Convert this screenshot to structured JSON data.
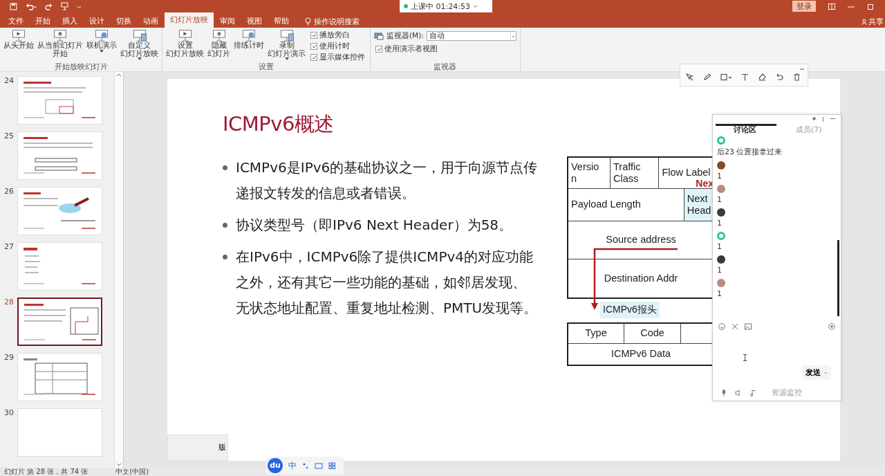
{
  "title_bar": {
    "status": "上课中 01:24:53",
    "login": "登录"
  },
  "ribbon_tabs": [
    {
      "label": "文件",
      "selected": false
    },
    {
      "label": "开始",
      "selected": false
    },
    {
      "label": "插入",
      "selected": false
    },
    {
      "label": "设计",
      "selected": false
    },
    {
      "label": "切换",
      "selected": false
    },
    {
      "label": "动画",
      "selected": false
    },
    {
      "label": "幻灯片放映",
      "selected": true
    },
    {
      "label": "审阅",
      "selected": false
    },
    {
      "label": "视图",
      "selected": false
    },
    {
      "label": "帮助",
      "selected": false
    }
  ],
  "search": "操作说明搜索",
  "share": "共享",
  "ribbon_groups": [
    {
      "label": "开始放映幻灯片",
      "items": [
        {
          "kind": "button",
          "lines": [
            "从头开始"
          ],
          "has_menu": false
        },
        {
          "kind": "button",
          "lines": [
            "从当前幻灯片",
            "开始"
          ],
          "has_menu": false
        },
        {
          "kind": "button",
          "lines": [
            "联机演示"
          ],
          "has_menu": true
        },
        {
          "kind": "button",
          "lines": [
            "自定义",
            "幻灯片放映"
          ],
          "has_menu": true
        }
      ]
    },
    {
      "label": "设置",
      "items": [
        {
          "kind": "button",
          "lines": [
            "设置",
            "幻灯片放映"
          ],
          "has_menu": false
        },
        {
          "kind": "button",
          "lines": [
            "隐藏",
            "幻灯片"
          ],
          "has_menu": false
        },
        {
          "kind": "button",
          "lines": [
            "排练计时"
          ],
          "has_menu": false
        },
        {
          "kind": "button",
          "lines": [
            "录制",
            "幻灯片演示"
          ],
          "has_menu": true
        },
        {
          "kind": "checks",
          "items": [
            {
              "label": "播放旁白",
              "checked": true
            },
            {
              "label": "使用计时",
              "checked": true
            },
            {
              "label": "显示媒体控件",
              "checked": true
            }
          ]
        }
      ]
    },
    {
      "label": "监视器",
      "items": [
        {
          "kind": "field",
          "label": "监视器(M):",
          "value": "自动"
        },
        {
          "kind": "checks",
          "items": [
            {
              "label": "使用演示者视图",
              "checked": true
            }
          ]
        }
      ]
    }
  ],
  "thumbnails": [
    {
      "number": "24",
      "selected": false
    },
    {
      "number": "25",
      "selected": false
    },
    {
      "number": "26",
      "selected": false
    },
    {
      "number": "27",
      "selected": false
    },
    {
      "number": "28",
      "selected": true
    },
    {
      "number": "29",
      "selected": false
    },
    {
      "number": "30",
      "selected": false
    }
  ],
  "slide": {
    "title": "ICMPv6概述",
    "bullets": [
      "ICMPv6是IPv6的基础协议之一，用于向源节点传递报文转发的信息或者错误。",
      "协议类型号（即IPv6 Next Header）为58。",
      "在IPv6中，ICMPv6除了提供ICMPv4的对应功能之外，还有其它一些功能的基础，如邻居发现、无状态地址配置、重复地址检测、PMTU发现等。"
    ],
    "ipv6_header": [
      {
        "cells": [
          {
            "text": "Versio\nn",
            "highlight": false
          },
          {
            "text": "Traffic\nClass",
            "highlight": false
          },
          {
            "text": "Flow Label",
            "highlight": false,
            "note": "Nex"
          }
        ]
      },
      {
        "cells": [
          {
            "text": "Payload Length",
            "highlight": false
          },
          {
            "text": "Next\nHead",
            "highlight": true
          }
        ]
      },
      {
        "cells": [
          {
            "text": "Source address",
            "highlight": false
          }
        ]
      },
      {
        "cells": [
          {
            "text": "Destination Addr",
            "highlight": false
          }
        ]
      }
    ],
    "arrow_label": "ICMPv6报头",
    "icmp_header": [
      {
        "open_end": true,
        "cells": [
          {
            "text": "Type",
            "highlight": false
          },
          {
            "text": "Code",
            "highlight": false
          }
        ]
      },
      {
        "open_end": false,
        "cells": [
          {
            "text": "ICMPv6 Data",
            "highlight": false
          }
        ]
      }
    ],
    "footer_fragment": "版"
  },
  "chat": {
    "tabs": [
      {
        "label": "讨论区",
        "selected": true
      },
      {
        "label": "成员(7)",
        "selected": false
      }
    ],
    "messages": [
      {
        "kind": "ring",
        "color": "#2bc98a",
        "text": "后23 位置接拿过来"
      },
      {
        "kind": "photo",
        "color": "#8a4a2a",
        "text": "1"
      },
      {
        "kind": "photo",
        "color": "#b98a80",
        "text": "1"
      },
      {
        "kind": "photo",
        "color": "#3a3a3a",
        "text": "1"
      },
      {
        "kind": "ring",
        "color": "#2bc98a",
        "text": "1"
      },
      {
        "kind": "photo",
        "color": "#3a3a3a",
        "text": "1"
      },
      {
        "kind": "photo",
        "color": "#b98a80",
        "text": "1"
      }
    ],
    "send": "发送",
    "monitor": "资源监控"
  },
  "ime": {
    "logo": "du",
    "mode": "中"
  },
  "status_bar": {
    "slide": "幻灯片 第 28 张，共 74 张",
    "language": "中文(中国)"
  }
}
